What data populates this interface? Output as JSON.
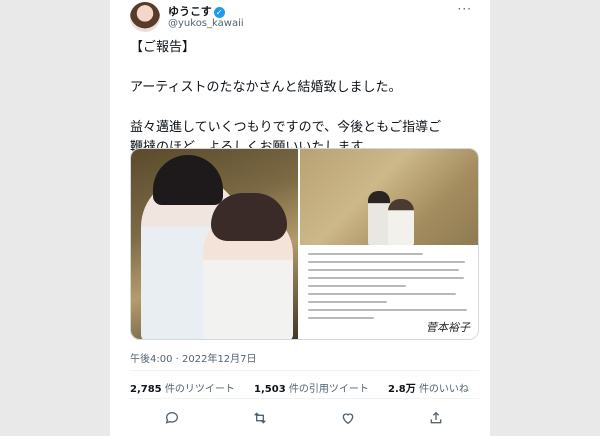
{
  "profile": {
    "display_name": "ゆうこす",
    "verified_mark": "✓",
    "handle": "@yukos_kawaii",
    "more_label": "···"
  },
  "tweet": {
    "lines": [
      "【ご報告】",
      "アーティストのたなかさんと結婚致しました。",
      "益々邁進していくつもりですので、今後ともご指導ご",
      "鞭撻のほど、よろしくお願いいたします。"
    ]
  },
  "media": {
    "left_photo": "couple-portrait-photo",
    "right_photo": "couple-on-rocks-photo",
    "letter_signature": "菅本裕子"
  },
  "timestamp": "午後4:00 · 2022年12月7日",
  "stats": {
    "retweets_count": "2,785",
    "retweets_label": "件のリツイート",
    "quotes_count": "1,503",
    "quotes_label": "件の引用ツイート",
    "likes_count": "2.8万",
    "likes_label": "件のいいね"
  },
  "actions": {
    "reply_icon": "reply-icon",
    "retweet_icon": "retweet-icon",
    "like_icon": "like-icon",
    "share_icon": "share-icon"
  },
  "colors": {
    "verified": "#1d9bf0",
    "text": "#0f1419",
    "secondary": "#536471"
  }
}
